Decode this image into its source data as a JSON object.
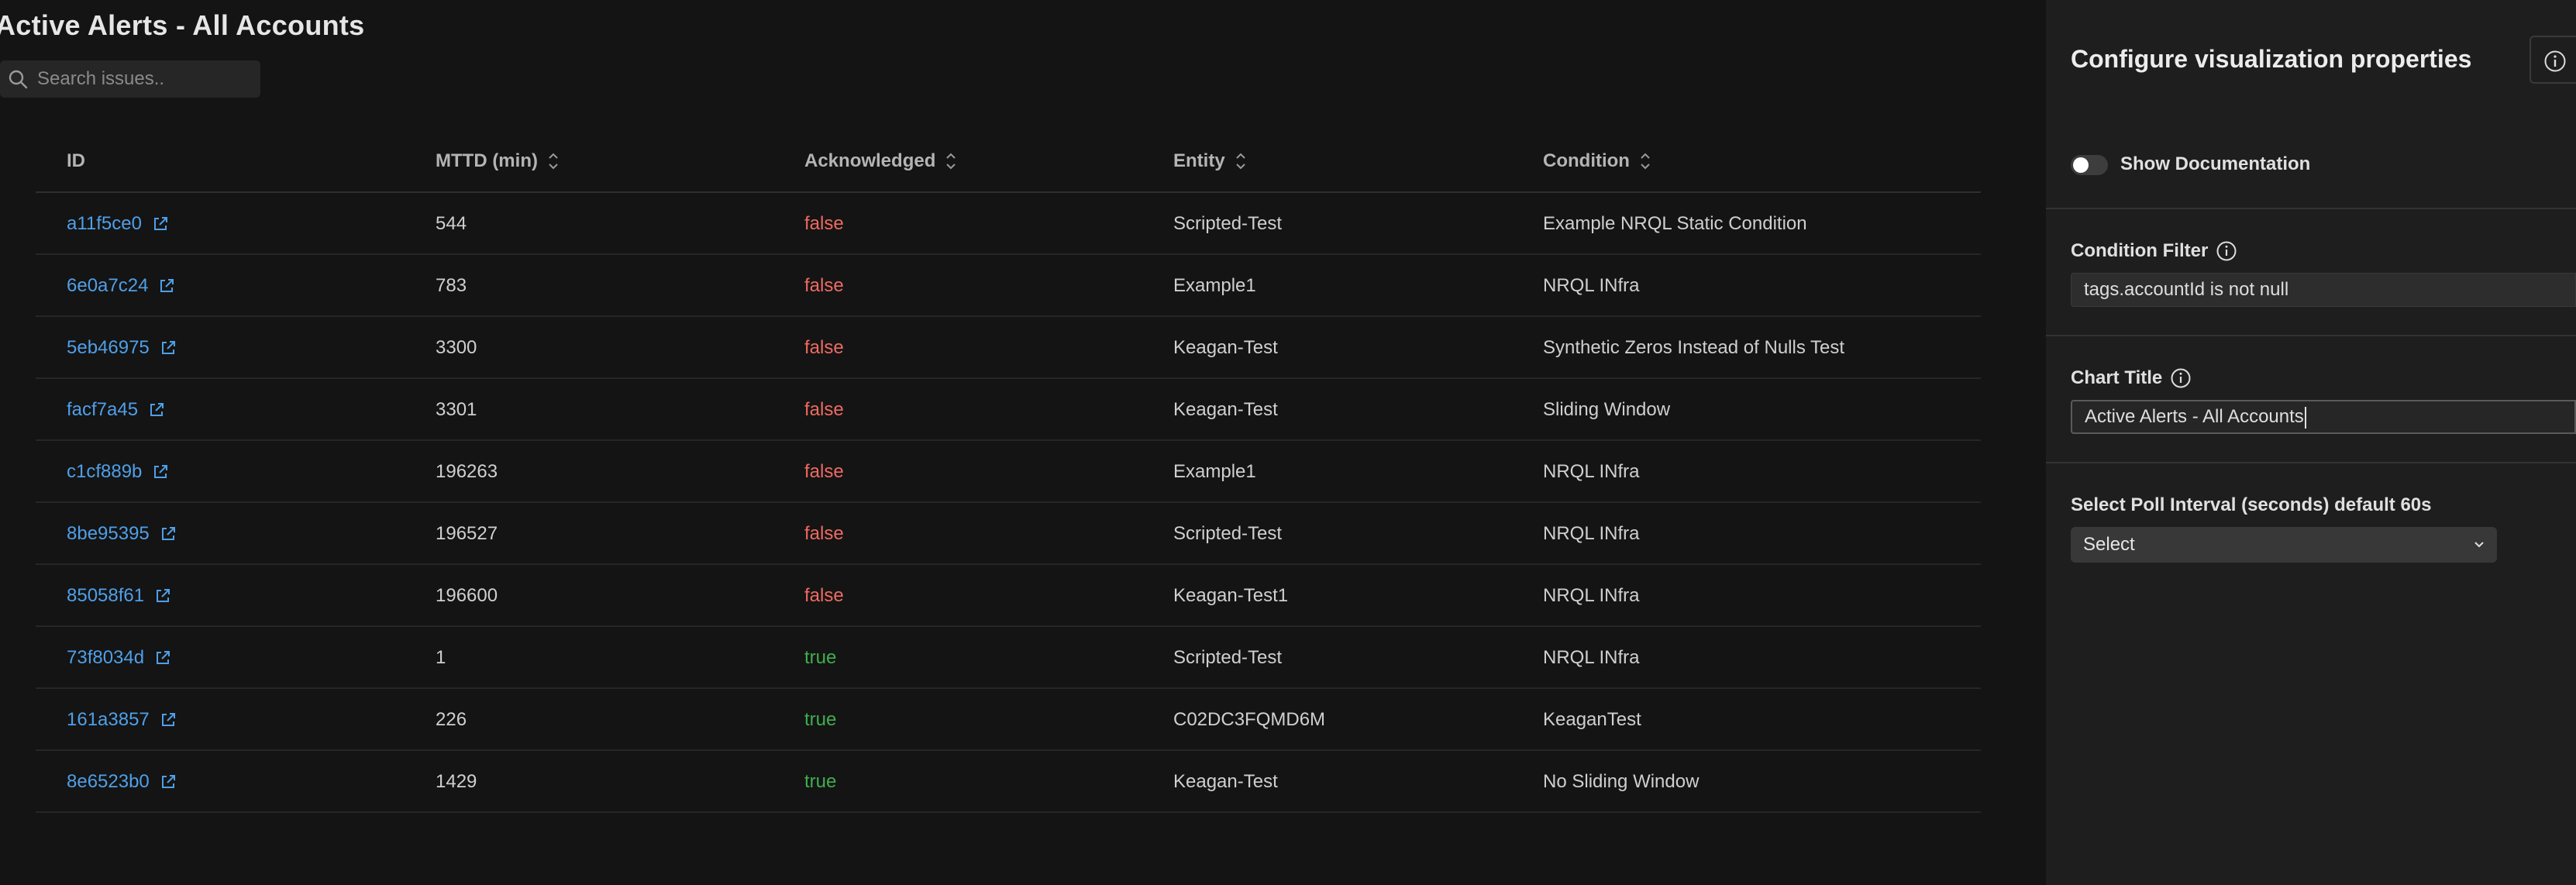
{
  "page": {
    "title": "Active Alerts - All Accounts",
    "search_placeholder": "Search issues.."
  },
  "table": {
    "columns": [
      {
        "label": "ID",
        "sortable": false
      },
      {
        "label": "MTTD (min)",
        "sortable": true
      },
      {
        "label": "Acknowledged",
        "sortable": true
      },
      {
        "label": "Entity",
        "sortable": true
      },
      {
        "label": "Condition",
        "sortable": true
      }
    ],
    "rows": [
      {
        "id": "a11f5ce0",
        "mttd": "544",
        "acknowledged": "false",
        "entity": "Scripted-Test",
        "condition": "Example NRQL Static Condition"
      },
      {
        "id": "6e0a7c24",
        "mttd": "783",
        "acknowledged": "false",
        "entity": "Example1",
        "condition": "NRQL INfra"
      },
      {
        "id": "5eb46975",
        "mttd": "3300",
        "acknowledged": "false",
        "entity": "Keagan-Test",
        "condition": "Synthetic Zeros Instead of Nulls Test"
      },
      {
        "id": "facf7a45",
        "mttd": "3301",
        "acknowledged": "false",
        "entity": "Keagan-Test",
        "condition": "Sliding Window"
      },
      {
        "id": "c1cf889b",
        "mttd": "196263",
        "acknowledged": "false",
        "entity": "Example1",
        "condition": "NRQL INfra"
      },
      {
        "id": "8be95395",
        "mttd": "196527",
        "acknowledged": "false",
        "entity": "Scripted-Test",
        "condition": "NRQL INfra"
      },
      {
        "id": "85058f61",
        "mttd": "196600",
        "acknowledged": "false",
        "entity": "Keagan-Test1",
        "condition": "NRQL INfra"
      },
      {
        "id": "73f8034d",
        "mttd": "1",
        "acknowledged": "true",
        "entity": "Scripted-Test",
        "condition": "NRQL INfra"
      },
      {
        "id": "161a3857",
        "mttd": "226",
        "acknowledged": "true",
        "entity": "C02DC3FQMD6M",
        "condition": "KeaganTest"
      },
      {
        "id": "8e6523b0",
        "mttd": "1429",
        "acknowledged": "true",
        "entity": "Keagan-Test",
        "condition": "No Sliding Window"
      }
    ]
  },
  "panel": {
    "title": "Configure visualization properties",
    "show_documentation_label": "Show Documentation",
    "show_documentation_on": false,
    "condition_filter_label": "Condition Filter",
    "condition_filter_value": "tags.accountId is not null",
    "chart_title_label": "Chart Title",
    "chart_title_value": "Active Alerts - All Accounts",
    "poll_interval_label": "Select Poll Interval (seconds) default 60s",
    "poll_interval_value": "Select"
  },
  "colors": {
    "link": "#4f9fe8",
    "false": "#ee6a62",
    "true": "#3fae4f"
  },
  "icons": {
    "search": "search-icon",
    "sort": "sort-icon",
    "external_link": "external-link-icon",
    "info": "info-icon",
    "chevron": "chevron-down-icon"
  }
}
